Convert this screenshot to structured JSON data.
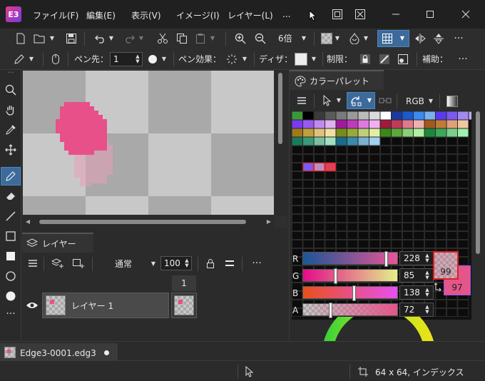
{
  "titlebar": {
    "logo": "E3",
    "menus": [
      "ファイル(F)",
      "編集(E)",
      "表示(V)",
      "イメージ(I)",
      "レイヤー(L)",
      "..."
    ],
    "controls": [
      "restore-icon",
      "close-box-icon",
      "minimize-icon",
      "maximize-icon",
      "close-icon"
    ]
  },
  "toolbar1": {
    "zoom_label": "6倍",
    "icons": [
      "new-file-icon",
      "open-folder-icon",
      "save-icon",
      "undo-icon",
      "redo-icon",
      "cut-icon",
      "copy-icon",
      "paste-icon",
      "zoom-in-icon",
      "zoom-out-icon",
      "transparency-icon",
      "fill-mode-icon",
      "grid-icon",
      "flip-horizontal-icon",
      "flip-vertical-icon",
      "more-icon"
    ]
  },
  "toolbar2": {
    "pen_tip_label": "ペン先：",
    "pen_tip_value": "1",
    "pen_effect_label": "ペン効果：",
    "dither_label": "ディザ：",
    "restrict_label": "制限：",
    "assist_label": "補助："
  },
  "tools": [
    "dots-grip-icon",
    "zoom-icon",
    "hand-icon",
    "eyedropper-icon",
    "move-icon",
    "pencil-icon",
    "eraser-icon",
    "line-icon",
    "rectangle-icon",
    "filled-rectangle-icon",
    "ellipse-icon",
    "filled-ellipse-icon",
    "more-tools-icon"
  ],
  "layer_panel": {
    "tab_label": "レイヤー",
    "blend_mode": "通常",
    "opacity": "100",
    "frame_number": "1",
    "layers": [
      {
        "name": "レイヤー 1",
        "visible": true
      }
    ]
  },
  "color_panel": {
    "tab_label": "カラーパレット",
    "mode_label": "RGB",
    "rgb": {
      "r_label": "R",
      "r_value": "228",
      "g_label": "G",
      "g_value": "85",
      "b_label": "B",
      "b_value": "138",
      "a_label": "A",
      "a_value": "72"
    },
    "swatch_slider_fraction": {
      "r": 0.894,
      "g": 0.333,
      "b": 0.541,
      "a": 0.282
    },
    "primary_index": "99",
    "secondary_index": "97",
    "palette_row1": [
      "#3a9a3a",
      "#000000",
      "#3a3a3a",
      "#5a5a5a",
      "#7a7a7a",
      "#9a9a9a",
      "#bababa",
      "#dadada",
      "#ffffff",
      "#1a3aa0",
      "#1a5ad0",
      "#3a8af0",
      "#7ab0f0",
      "#5a3af0",
      "#7a5af0",
      "#a08af0",
      "#c0b0f0"
    ],
    "palette_row2": [
      "#7a3af0",
      "#9a5af0",
      "#c08af0",
      "#e0b0f0",
      "#a01aa0",
      "#c03ac0",
      "#e07ae0",
      "#f0b0f0",
      "#a01a3a",
      "#c03a5a",
      "#e07a8a",
      "#f0b0b0",
      "#a05a1a",
      "#c07a3a",
      "#e0a07a",
      "#f0c8a0"
    ],
    "palette_row3": [
      "#a07a1a",
      "#c0a03a",
      "#e0c07a",
      "#f0e0a0",
      "#7a8a1a",
      "#9aaa3a",
      "#c0d07a",
      "#e0f0a0",
      "#3a8a1a",
      "#5aaa3a",
      "#8ad07a",
      "#b0f0a0",
      "#1a8a3a",
      "#3aaa5a",
      "#7ad08a",
      "#a0f0b0"
    ],
    "palette_row4": [
      "#1a7a5a",
      "#3a9a7a",
      "#7ac0a0",
      "#a0e0c0",
      "#1a6a8a",
      "#3a8aaa",
      "#7ab0d0",
      "#a0d0f0"
    ],
    "palette_used": [
      "#7a5af0",
      "#c08ac0",
      "#e0405a"
    ]
  },
  "canvas": {
    "image_caption": "pink blob on transparent checkerboard"
  },
  "statusbar": {
    "tab_label": "Edge3-0001.edg3",
    "info": "64 x 64, インデックス"
  }
}
